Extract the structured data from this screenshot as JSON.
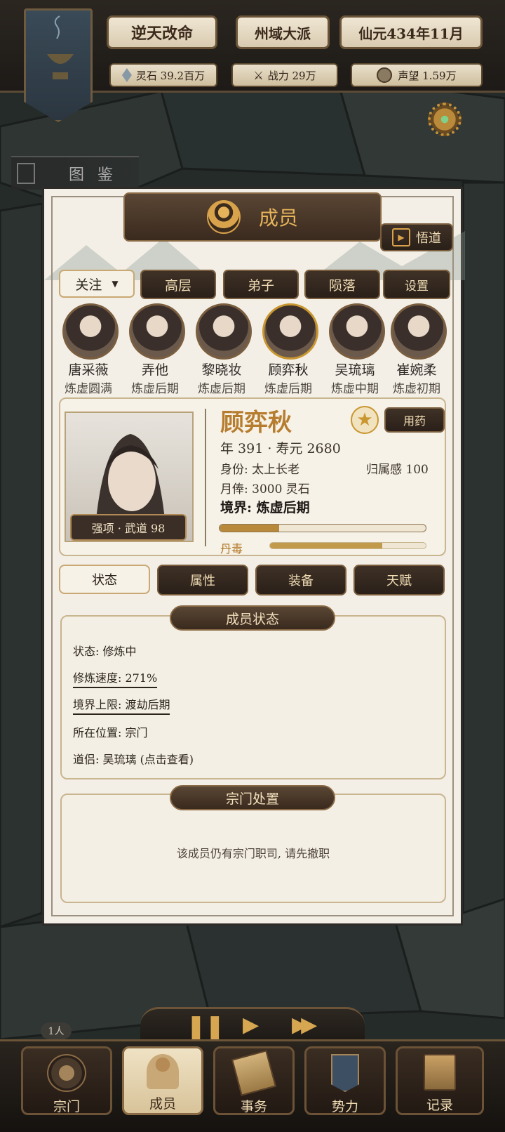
{
  "top": {
    "title_left": "逆天改命",
    "title_mid": "州域大派",
    "date": "仙元434年11月",
    "spirit_stones": "灵石 39.2百万",
    "power": "战力 29万",
    "prestige": "声望 1.59万"
  },
  "sidebar": {
    "codex": "图 鉴"
  },
  "panel": {
    "title": "成员",
    "enlighten": "悟道",
    "filter": "关注",
    "tabs": [
      "高层",
      "弟子",
      "陨落",
      "设置"
    ],
    "members": [
      {
        "name": "唐采薇",
        "stage": "炼虚圆满"
      },
      {
        "name": "弄他",
        "stage": "炼虚后期"
      },
      {
        "name": "黎晓妆",
        "stage": "炼虚后期"
      },
      {
        "name": "顾弈秋",
        "stage": "炼虚后期"
      },
      {
        "name": "吴琉璃",
        "stage": "炼虚中期"
      },
      {
        "name": "崔婉柔",
        "stage": "炼虚初期"
      }
    ],
    "detail": {
      "name": "顾弈秋",
      "medicine": "用药",
      "age": "年 391 · 寿元 2680",
      "identity": "身份: 太上长老",
      "belonging": "归属感 100",
      "salary": "月俸: 3000 灵石",
      "realm": "境界: 炼虚后期",
      "strength": "强项 · 武道 98",
      "poison_label": "丹毒",
      "progress_fraction": 0.29,
      "poison_fraction": 0.72
    },
    "subtabs": [
      "状态",
      "属性",
      "装备",
      "天赋"
    ],
    "status_title": "成员状态",
    "status": [
      "状态: 修炼中",
      "修炼速度: 271%",
      "境界上限: 渡劫后期",
      "所在位置: 宗门",
      "道侣: 吴琉璃 (点击查看)"
    ],
    "disposal_title": "宗门处置",
    "disposal_msg": "该成员仍有宗门职司, 请先撤职"
  },
  "footer": {
    "count": "1人",
    "nav": [
      "宗门",
      "成员",
      "事务",
      "势力",
      "记录"
    ]
  },
  "colors": {
    "gold": "#c9962f",
    "wood": "#3f3126",
    "parchment": "#f3efe6"
  }
}
